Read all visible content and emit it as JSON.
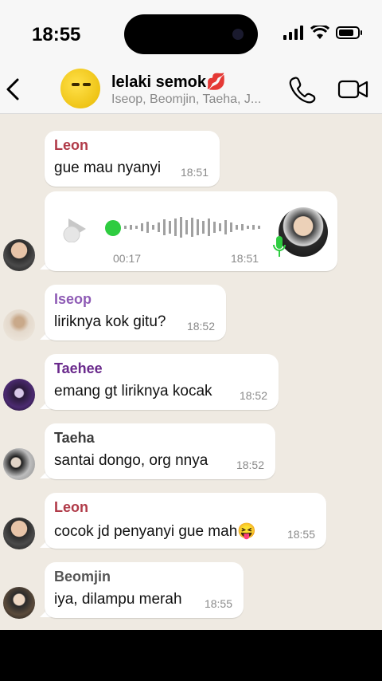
{
  "status": {
    "time": "18:55"
  },
  "header": {
    "group_name": "lelaki semok",
    "group_emoji": "💋",
    "members": "Iseop, Beomjin, Taeha, J..."
  },
  "messages": [
    {
      "sender": "Leon",
      "sender_color": "#b03a48",
      "text": "gue mau nyanyi",
      "time": "18:51"
    },
    {
      "type": "voice",
      "duration": "00:17",
      "time": "18:51"
    },
    {
      "sender": "Iseop",
      "sender_color": "#8e5bb5",
      "text": "liriknya kok gitu?",
      "time": "18:52"
    },
    {
      "sender": "Taehee",
      "sender_color": "#6a2a8c",
      "text": "emang gt liriknya kocak",
      "time": "18:52"
    },
    {
      "sender": "Taeha",
      "sender_color": "#3b3b3b",
      "text": "santai dongo, org nnya",
      "time": "18:52"
    },
    {
      "sender": "Leon",
      "sender_color": "#b03a48",
      "text": "cocok jd penyanyi gue mah😝",
      "time": "18:55"
    },
    {
      "sender": "Beomjin",
      "sender_color": "#555555",
      "text": "iya, dilampu merah",
      "time": "18:55"
    }
  ],
  "icons": {
    "back": "chevron-left-icon",
    "call": "phone-icon",
    "video": "video-camera-icon",
    "play": "play-icon",
    "mic": "microphone-icon"
  }
}
